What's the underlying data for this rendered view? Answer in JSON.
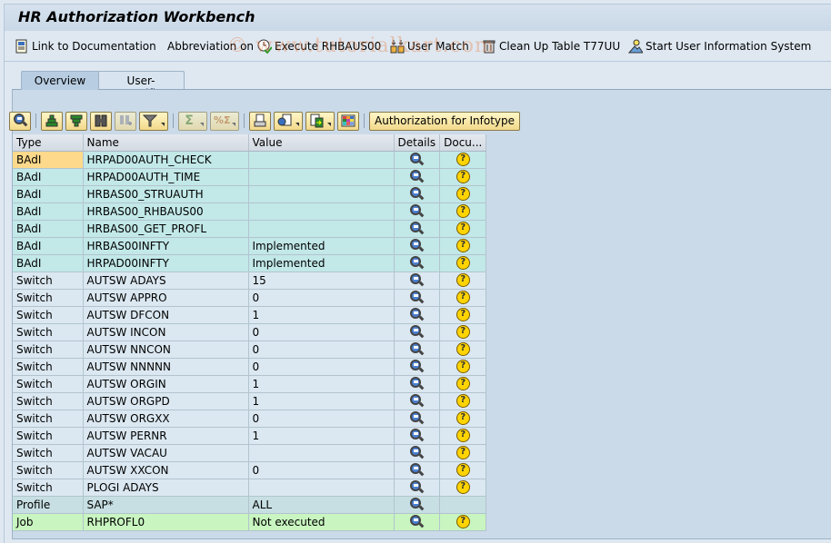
{
  "window": {
    "title": "HR Authorization Workbench"
  },
  "appbar": {
    "items": [
      {
        "label": "Link to Documentation",
        "icon": "document-icon"
      },
      {
        "label": "Abbreviation on",
        "icon": ""
      },
      {
        "label": "Execute RHBAUS00",
        "icon": "execute-clock-icon"
      },
      {
        "label": "User Match",
        "icon": "user-match-icon"
      },
      {
        "label": "Clean Up Table T77UU",
        "icon": "trash-icon"
      },
      {
        "label": "Start User Information System",
        "icon": "user-info-icon"
      }
    ]
  },
  "watermark": "© www.tutorialkart.com",
  "tabs": [
    {
      "label": "Overview",
      "active": true
    },
    {
      "label": "User-specific",
      "active": false
    }
  ],
  "grid_toolbar": {
    "buttons": [
      {
        "name": "details",
        "icon": "details-icon"
      },
      {
        "name": "sort-ascending",
        "icon": "sort-ascending-icon"
      },
      {
        "name": "sort-descending",
        "icon": "sort-descending-icon"
      },
      {
        "name": "find",
        "icon": "find-icon"
      },
      {
        "name": "find-next",
        "icon": "find-next-icon",
        "disabled": true
      },
      {
        "name": "filter",
        "icon": "filter-icon",
        "dropdown": true
      },
      {
        "name": "total",
        "icon": "sum-icon",
        "dropdown": true,
        "disabled": true
      },
      {
        "name": "subtotal",
        "icon": "subtotal-icon",
        "dropdown": true,
        "disabled": true
      },
      {
        "name": "print",
        "icon": "print-icon"
      },
      {
        "name": "views",
        "icon": "views-icon",
        "dropdown": true
      },
      {
        "name": "export",
        "icon": "export-icon",
        "dropdown": true
      },
      {
        "name": "layout",
        "icon": "layout-grid-icon"
      }
    ],
    "auth_infotype_label": "Authorization for Infotype"
  },
  "table": {
    "columns": [
      "Type",
      "Name",
      "Value",
      "Details",
      "Docu..."
    ],
    "rows": [
      {
        "type": "BAdI",
        "name": "HRPAD00AUTH_CHECK",
        "value": "",
        "kind": "badi",
        "doc": true,
        "selected": true
      },
      {
        "type": "BAdI",
        "name": "HRPAD00AUTH_TIME",
        "value": "",
        "kind": "badi",
        "doc": true
      },
      {
        "type": "BAdI",
        "name": "HRBAS00_STRUAUTH",
        "value": "",
        "kind": "badi",
        "doc": true
      },
      {
        "type": "BAdI",
        "name": "HRBAS00_RHBAUS00",
        "value": "",
        "kind": "badi",
        "doc": true
      },
      {
        "type": "BAdI",
        "name": "HRBAS00_GET_PROFL",
        "value": "",
        "kind": "badi",
        "doc": true
      },
      {
        "type": "BAdI",
        "name": "HRBAS00INFTY",
        "value": "Implemented",
        "kind": "badi",
        "doc": true
      },
      {
        "type": "BAdI",
        "name": "HRPAD00INFTY",
        "value": "Implemented",
        "kind": "badi",
        "doc": true
      },
      {
        "type": "Switch",
        "name": "AUTSW ADAYS",
        "value": "15",
        "kind": "switch",
        "doc": true
      },
      {
        "type": "Switch",
        "name": "AUTSW APPRO",
        "value": "0",
        "kind": "switch",
        "doc": true
      },
      {
        "type": "Switch",
        "name": "AUTSW DFCON",
        "value": "1",
        "kind": "switch",
        "doc": true
      },
      {
        "type": "Switch",
        "name": "AUTSW INCON",
        "value": "0",
        "kind": "switch",
        "doc": true
      },
      {
        "type": "Switch",
        "name": "AUTSW NNCON",
        "value": "0",
        "kind": "switch",
        "doc": true
      },
      {
        "type": "Switch",
        "name": "AUTSW NNNNN",
        "value": "0",
        "kind": "switch",
        "doc": true
      },
      {
        "type": "Switch",
        "name": "AUTSW ORGIN",
        "value": "1",
        "kind": "switch",
        "doc": true
      },
      {
        "type": "Switch",
        "name": "AUTSW ORGPD",
        "value": "1",
        "kind": "switch",
        "doc": true
      },
      {
        "type": "Switch",
        "name": "AUTSW ORGXX",
        "value": "0",
        "kind": "switch",
        "doc": true
      },
      {
        "type": "Switch",
        "name": "AUTSW PERNR",
        "value": "1",
        "kind": "switch",
        "doc": true
      },
      {
        "type": "Switch",
        "name": "AUTSW VACAU",
        "value": "",
        "kind": "switch",
        "doc": true
      },
      {
        "type": "Switch",
        "name": "AUTSW XXCON",
        "value": "0",
        "kind": "switch",
        "doc": true
      },
      {
        "type": "Switch",
        "name": "PLOGI ADAYS",
        "value": "",
        "kind": "switch",
        "doc": true
      },
      {
        "type": "Profile",
        "name": "SAP*",
        "value": "ALL",
        "kind": "profile",
        "doc": false
      },
      {
        "type": "Job",
        "name": "RHPROFL0",
        "value": "Not executed",
        "kind": "job",
        "doc": true
      }
    ]
  },
  "colors": {
    "badi_row": "#c2e8e8",
    "switch_row": "#dbe8f1",
    "profile_row": "#c7dfe2",
    "job_row": "#c8f5c0",
    "selected_cell": "#fdd98b",
    "button_bg": "#f8e9a8"
  }
}
